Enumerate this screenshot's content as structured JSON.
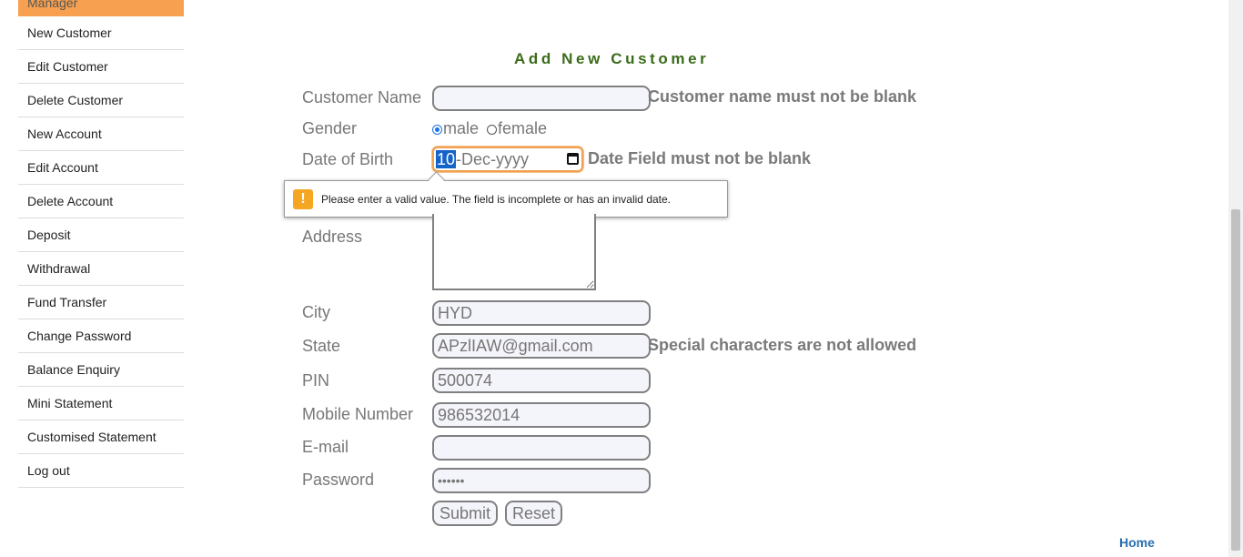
{
  "sidebar": {
    "header": "Manager",
    "items": [
      {
        "label": "New Customer"
      },
      {
        "label": "Edit Customer"
      },
      {
        "label": "Delete Customer"
      },
      {
        "label": "New Account"
      },
      {
        "label": "Edit Account"
      },
      {
        "label": "Delete Account"
      },
      {
        "label": "Deposit"
      },
      {
        "label": "Withdrawal"
      },
      {
        "label": "Fund Transfer"
      },
      {
        "label": "Change Password"
      },
      {
        "label": "Balance Enquiry"
      },
      {
        "label": "Mini Statement"
      },
      {
        "label": "Customised Statement"
      },
      {
        "label": "Log out"
      }
    ]
  },
  "form": {
    "title": "Add New Customer",
    "labels": {
      "customer_name": "Customer Name",
      "gender": "Gender",
      "dob": "Date of Birth",
      "address": "Address",
      "city": "City",
      "state": "State",
      "pin": "PIN",
      "mobile": "Mobile Number",
      "email": "E-mail",
      "password": "Password"
    },
    "gender_options": {
      "male": "male",
      "female": "female",
      "selected": "male"
    },
    "values": {
      "customer_name": "",
      "dob_day": "10",
      "dob_rest": "-Dec-yyyy",
      "address": "",
      "city": "HYD",
      "state": "APzlIAW@gmail.com",
      "pin": "500074",
      "mobile": "986532014",
      "email": "",
      "password": "••••••"
    },
    "errors": {
      "customer_name": "Customer name must not be blank",
      "dob": "Date Field must not be blank",
      "state": "Special characters are not allowed"
    },
    "tooltip": "Please enter a valid value. The field is incomplete or has an invalid date.",
    "tooltip_icon": "!",
    "buttons": {
      "submit": "Submit",
      "reset": "Reset"
    }
  },
  "footer": {
    "home_link": "Home"
  },
  "colors": {
    "accent": "#f7a050",
    "title": "#3a6b1a",
    "link": "#2a6fb0",
    "warning": "#f5a623",
    "selection": "#1463c9"
  }
}
